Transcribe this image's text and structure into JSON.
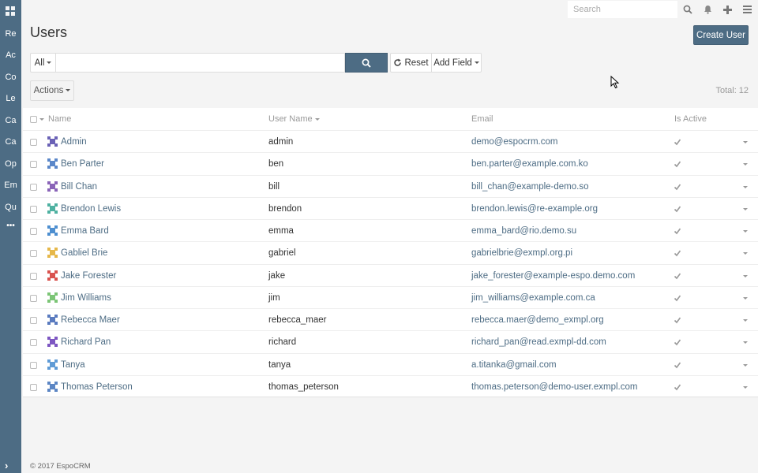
{
  "sidebar": {
    "items": [
      "Re",
      "Ac",
      "Co",
      "Le",
      "Ca",
      "Ca",
      "Op",
      "Em",
      "Qu"
    ],
    "more": "•••"
  },
  "topbar": {
    "search_placeholder": "Search"
  },
  "header": {
    "title": "Users",
    "create_label": "Create User"
  },
  "filter": {
    "all_label": "All",
    "reset_label": "Reset",
    "add_field_label": "Add Field"
  },
  "actions_label": "Actions",
  "total": {
    "label": "Total:",
    "value": "12"
  },
  "table": {
    "columns": [
      "Name",
      "User Name",
      "Email",
      "Is Active"
    ],
    "rows": [
      {
        "name": "Admin",
        "username": "admin",
        "email": "demo@espocrm.com",
        "color": "#6b62b6"
      },
      {
        "name": "Ben Parter",
        "username": "ben",
        "email": "ben.parter@example.com.ko",
        "color": "#5b87c9"
      },
      {
        "name": "Bill Chan",
        "username": "bill",
        "email": "bill_chan@example-demo.so",
        "color": "#8a64b8"
      },
      {
        "name": "Brendon Lewis",
        "username": "brendon",
        "email": "brendon.lewis@re-example.org",
        "color": "#4fb1a1"
      },
      {
        "name": "Emma Bard",
        "username": "emma",
        "email": "emma_bard@rio.demo.su",
        "color": "#4e8fd0"
      },
      {
        "name": "Gabliel Brie",
        "username": "gabriel",
        "email": "gabrielbrie@exmpl.org.pi",
        "color": "#e6b84a"
      },
      {
        "name": "Jake Forester",
        "username": "jake",
        "email": "jake_forester@example-espo.demo.com",
        "color": "#d9534f"
      },
      {
        "name": "Jim Williams",
        "username": "jim",
        "email": "jim_williams@example.com.ca",
        "color": "#7cc576"
      },
      {
        "name": "Rebecca Maer",
        "username": "rebecca_maer",
        "email": "rebecca.maer@demo_exmpl.org",
        "color": "#5a7bbf"
      },
      {
        "name": "Richard Pan",
        "username": "richard",
        "email": "richard_pan@read.exmpl-dd.com",
        "color": "#7e57c2"
      },
      {
        "name": "Tanya",
        "username": "tanya",
        "email": "a.titanka@gmail.com",
        "color": "#5f9bd6"
      },
      {
        "name": "Thomas Peterson",
        "username": "thomas_peterson",
        "email": "thomas.peterson@demo-user.exmpl.com",
        "color": "#5c86c4"
      }
    ]
  },
  "footer": "© 2017 EspoCRM"
}
